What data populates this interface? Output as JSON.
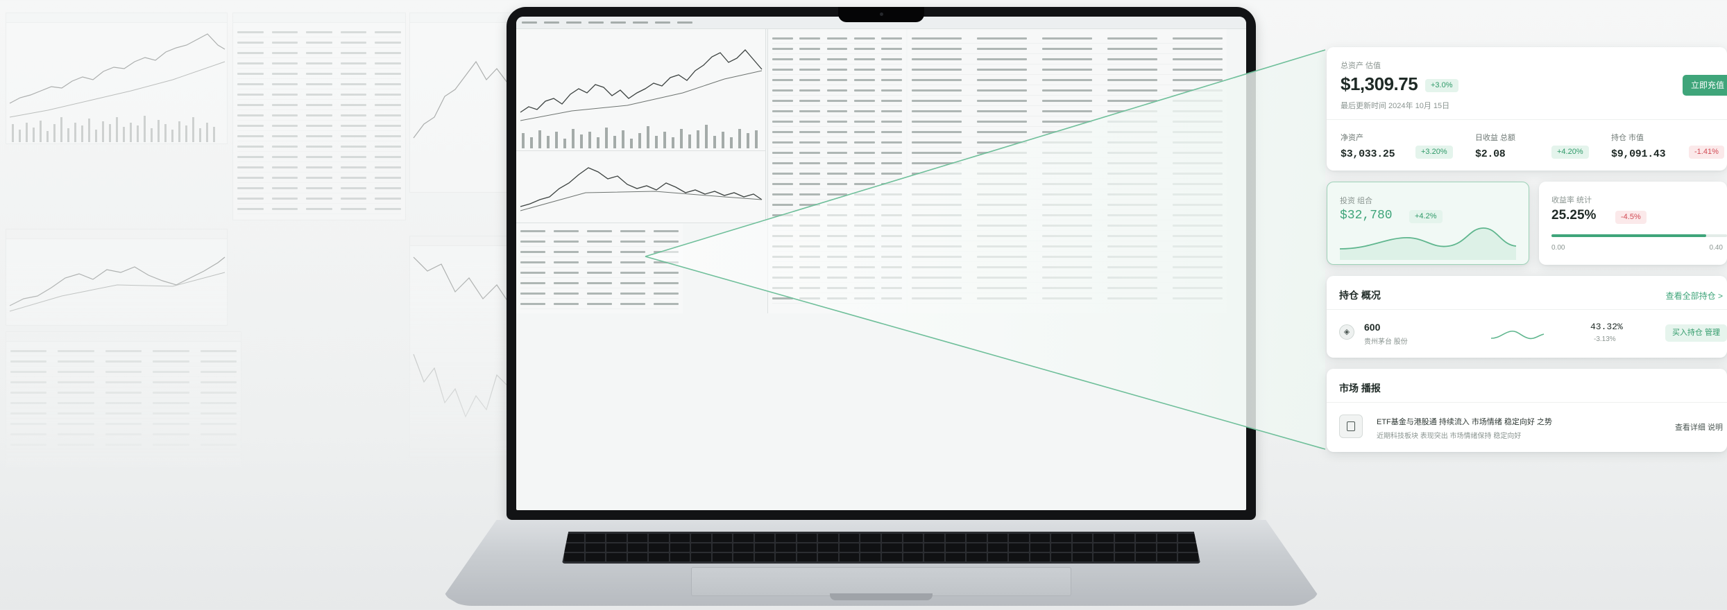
{
  "balance_card": {
    "label": "总资产 估值",
    "value": "$1,309.75",
    "change_badge": "+3.0%",
    "subtitle": "最后更新时间 2024年 10月 15日",
    "action_label": "立即充值"
  },
  "kpis": [
    {
      "label": "净资产",
      "value": "$3,033.25",
      "change": "+3.20%",
      "tone": "up"
    },
    {
      "label": "日收益 总额",
      "value": "$2.08",
      "change": "+4.20%",
      "tone": "up"
    },
    {
      "label": "持仓 市值",
      "value": "$9,091.43",
      "change": "-1.41%",
      "tone": "down"
    }
  ],
  "portfolio_card": {
    "label": "投资 组合",
    "value": "$32,780",
    "change_badge": "+4.2%"
  },
  "rate_card": {
    "label": "收益率 统计",
    "value": "25.25%",
    "change_badge": "-4.5%",
    "progress": 0.88,
    "range_left": "0.00",
    "range_right": "0.40"
  },
  "positions": {
    "title": "持仓 概况",
    "view_all": "查看全部持仓 >",
    "rows": [
      {
        "symbol": "600",
        "name": "贵州茅台 股份",
        "pct": "43.32%",
        "delta": "-3.13%",
        "action": "买入持仓 管理"
      }
    ]
  },
  "notice": {
    "title": "市场 播报",
    "headline": "ETF基金与港股通 持续流入 市场情绪 稳定向好 之势",
    "detail": "近期科技板块 表现突出 市场情绪保持 稳定向好",
    "action": "查看详细 说明"
  },
  "colors": {
    "accent": "#3fa57a",
    "up": "#2f9a69",
    "down": "#d14a54"
  }
}
